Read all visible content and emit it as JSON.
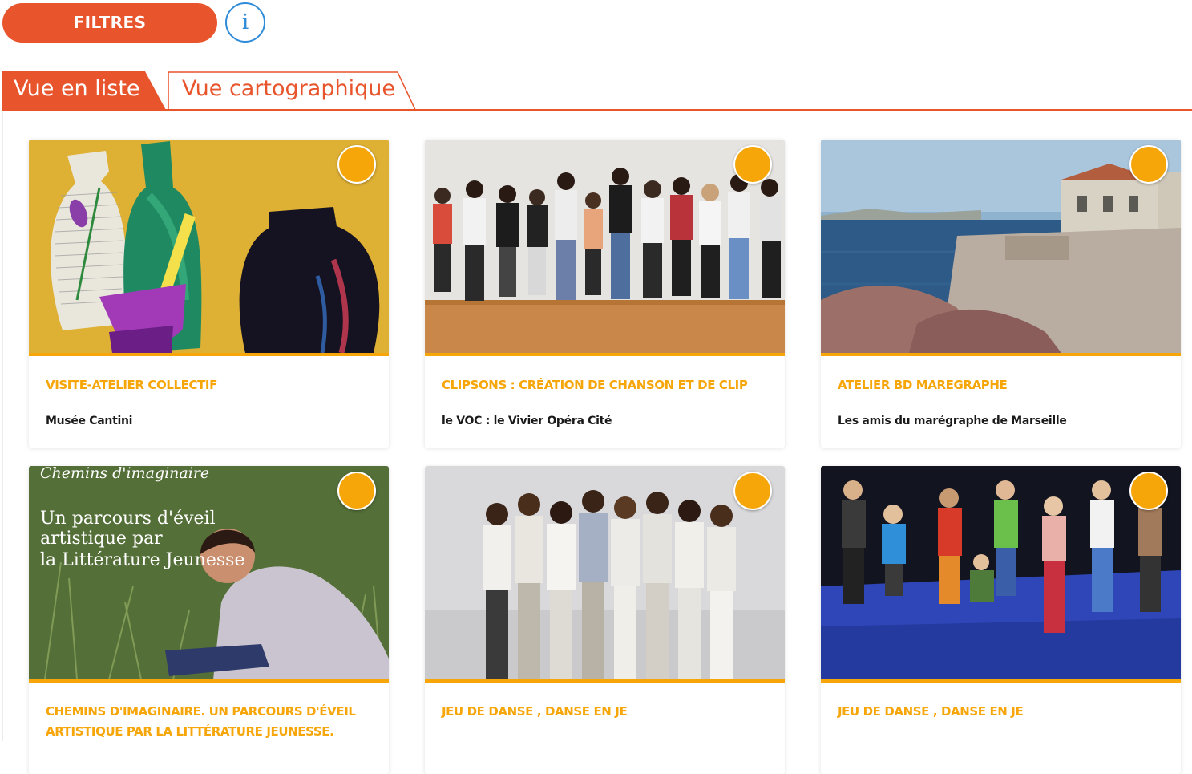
{
  "toolbar": {
    "filters_label": "FILTRES",
    "info_label": "i"
  },
  "tabs": [
    {
      "label": "Vue en liste",
      "active": true
    },
    {
      "label": "Vue cartographique",
      "active": false
    }
  ],
  "colors": {
    "accent": "#e8542c",
    "card_accent": "#f6a609",
    "info": "#2e8bd8"
  },
  "cards": [
    {
      "title": "VISITE-ATELIER COLLECTIF",
      "subtitle": "Musée Cantini"
    },
    {
      "title": "CLIPSONS : CRÉATION DE CHANSON ET DE CLIP",
      "subtitle": "le VOC : le Vivier Opéra Cité"
    },
    {
      "title": "ATELIER BD MAREGRAPHE",
      "subtitle": "Les amis du marégraphe de Marseille"
    },
    {
      "title": "CHEMINS D'IMAGINAIRE. UN PARCOURS D'ÉVEIL ARTISTIQUE PAR LA LITTÉRATURE JEUNESSE.",
      "subtitle": "",
      "image_text": {
        "line1": "Chemins d'imaginaire",
        "line2": "Un parcours d'éveil",
        "line3": "artistique par",
        "line4": "la Littérature Jeunesse"
      }
    },
    {
      "title": "JEU DE DANSE , DANSE EN JE",
      "subtitle": ""
    },
    {
      "title": "JEU DE DANSE , DANSE EN JE",
      "subtitle": ""
    }
  ]
}
